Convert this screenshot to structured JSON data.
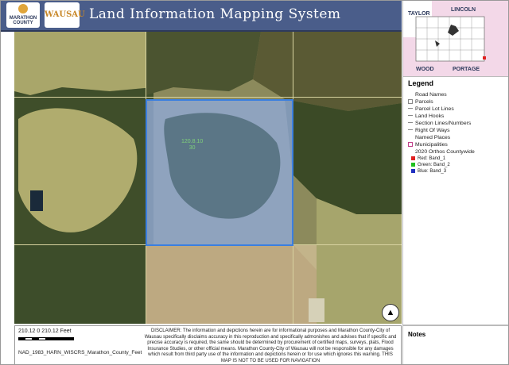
{
  "header": {
    "title": "Land Information Mapping System",
    "logo1_text": "MARATHON COUNTY",
    "logo2_text": "WAUSAU"
  },
  "map": {
    "parcel_label_line1": "120.8.10",
    "parcel_label_line2": "30",
    "north_arrow": "▲"
  },
  "overview": {
    "labels": {
      "taylor": "TAYLOR",
      "lincoln": "LINCOLN",
      "wood": "WOOD",
      "portage": "PORTAGE"
    }
  },
  "legend": {
    "title": "Legend",
    "items": [
      {
        "label": "Road Names",
        "symbol": "none"
      },
      {
        "label": "Parcels",
        "symbol": "box"
      },
      {
        "label": "Parcel Lot Lines",
        "symbol": "line"
      },
      {
        "label": "Land Hooks",
        "symbol": "line"
      },
      {
        "label": "Section Lines/Numbers",
        "symbol": "line"
      },
      {
        "label": "Right Of Ways",
        "symbol": "line"
      },
      {
        "label": "Named Places",
        "symbol": "none"
      },
      {
        "label": "Municipalities",
        "symbol": "box"
      },
      {
        "label": "2020 Orthos Countywide",
        "symbol": "none"
      }
    ],
    "bands": [
      {
        "prefix": "Red:",
        "label": "Band_1",
        "color": "#e02020"
      },
      {
        "prefix": "Green:",
        "label": "Band_2",
        "color": "#20c020"
      },
      {
        "prefix": "Blue:",
        "label": "Band_3",
        "color": "#2030c0"
      }
    ]
  },
  "scale": {
    "text": "210.12    0    210.12 Feet",
    "projection": "NAD_1983_HARN_WISCRS_Marathon_County_Feet"
  },
  "disclaimer": "DISCLAIMER: The information and depictions herein are for informational purposes and Marathon County-City of Wausau specifically disclaims accuracy in this reproduction and specifically admonishes and advises that if specific and precise accuracy is required, the same should be determined by procurement of certified maps, surveys, plats, Flood Insurance Studies, or other official means. Marathon County-City of Wausau will not be responsible for any damages which result from third party use of the information and depictions herein or for use which ignores this warning. THIS MAP IS NOT TO BE USED FOR NAVIGATION",
  "notes": {
    "title": "Notes"
  },
  "colors": {
    "header": "#4a5d8a",
    "parcel_highlight": "#4f8fe0",
    "field": "#a9a66a",
    "forest": "#3b4a26"
  }
}
